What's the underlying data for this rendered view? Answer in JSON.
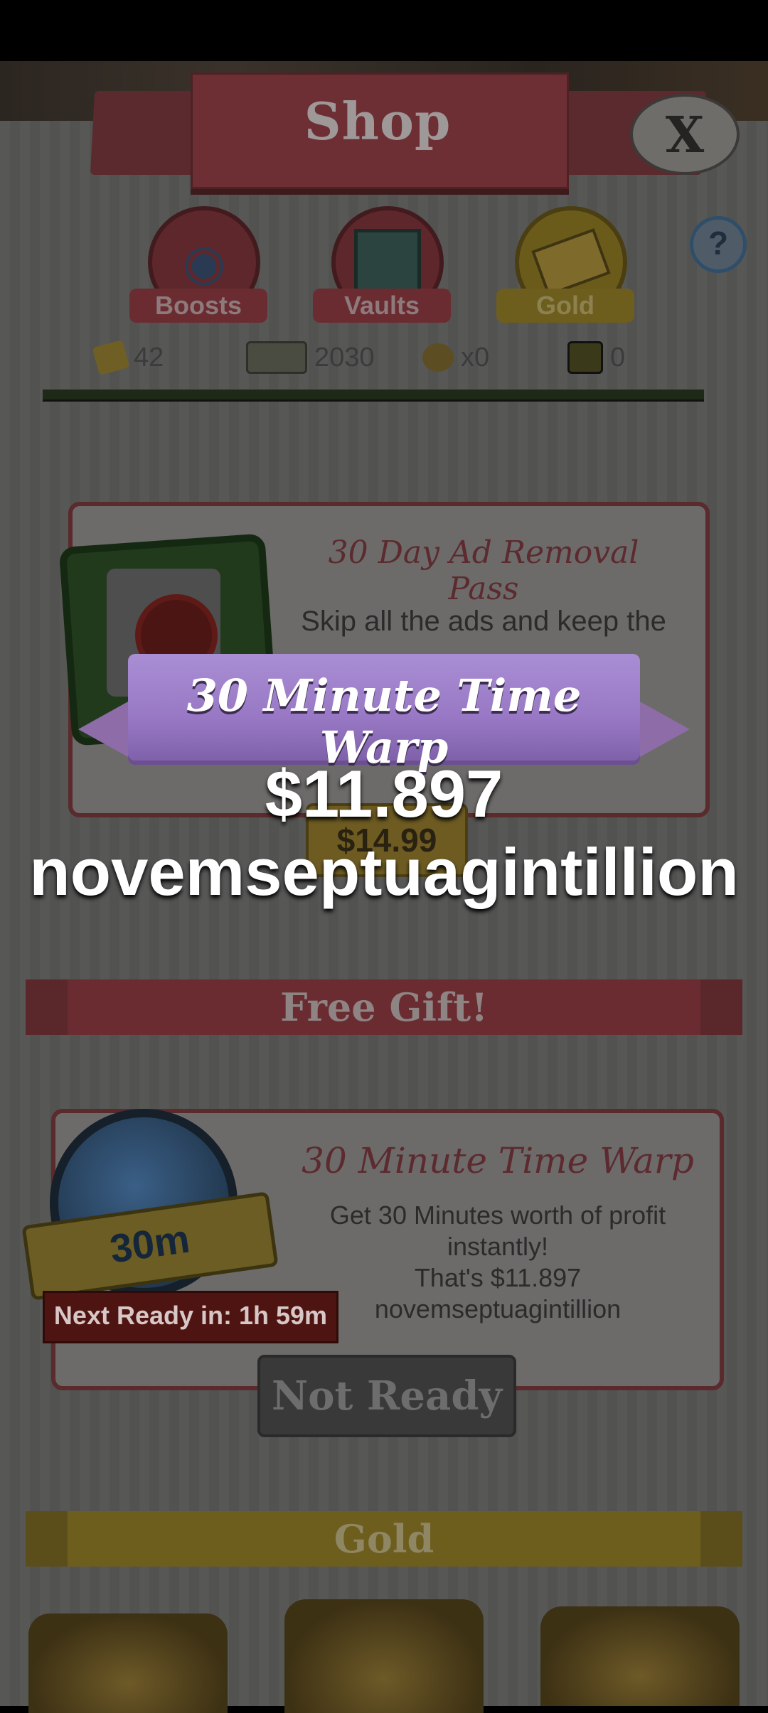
{
  "header": {
    "title": "Shop",
    "close_label": "X"
  },
  "tabs": [
    {
      "label": "Boosts",
      "color": "#6a2c31"
    },
    {
      "label": "Vaults",
      "color": "#6a2c31"
    },
    {
      "label": "Gold",
      "color": "#6e5e1e"
    }
  ],
  "help_label": "?",
  "currencies": [
    {
      "icon": "gold-bar-icon",
      "value": "42"
    },
    {
      "icon": "cash-icon",
      "value": "2030"
    },
    {
      "icon": "money-bag-icon",
      "value": "x0"
    },
    {
      "icon": "mega-icon",
      "value": "0"
    }
  ],
  "ad_removal": {
    "title": "30 Day Ad Removal Pass",
    "description": "Skip all the ads and keep the",
    "price": "$14.99"
  },
  "popup": {
    "ribbon_text": "30 Minute Time Warp",
    "value_line1": "$11.897",
    "value_line2": "novemseptuagintillion"
  },
  "free_gift": {
    "section_label": "Free Gift!",
    "title": "30 Minute Time Warp",
    "desc_line1": "Get 30 Minutes worth of profit",
    "desc_line2": "instantly!",
    "desc_line3": "That's $11.897 novemseptuagintillion",
    "badge": "30m",
    "next_ready": "Next Ready in: 1h 59m",
    "button_label": "Not Ready"
  },
  "gold_section": {
    "label": "Gold"
  },
  "colors": {
    "ribbon": "#9878c4",
    "red_section": "#6a2c31",
    "gold_section": "#6e5e1e"
  }
}
